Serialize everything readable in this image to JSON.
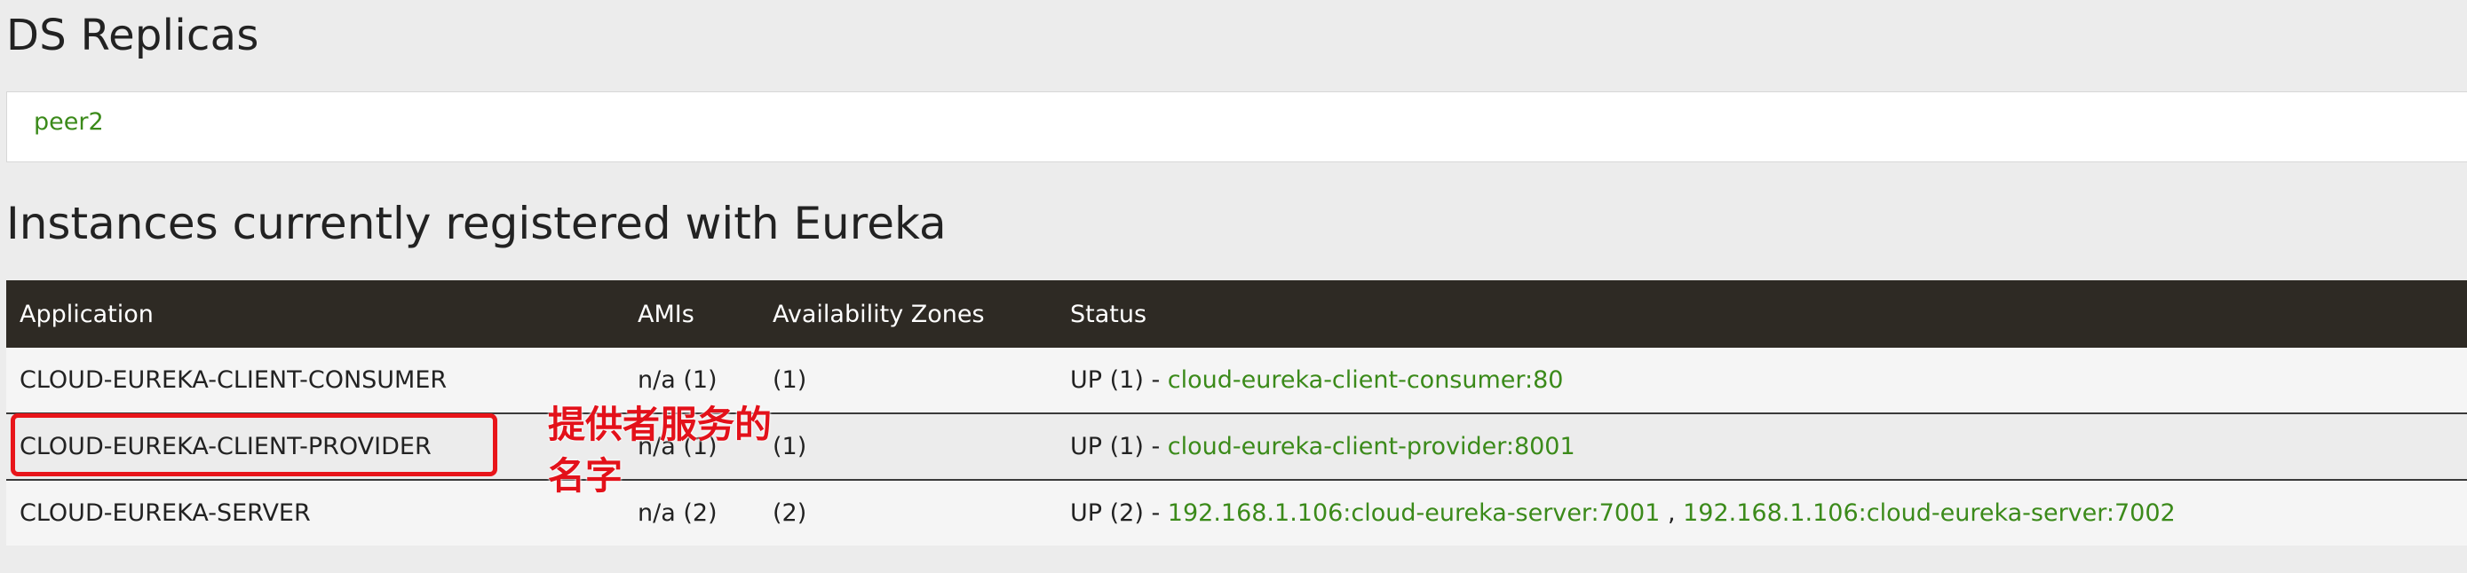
{
  "ds_replicas": {
    "heading": "DS Replicas",
    "peers": [
      "peer2"
    ]
  },
  "instances": {
    "heading": "Instances currently registered with Eureka",
    "columns": [
      "Application",
      "AMIs",
      "Availability Zones",
      "Status"
    ],
    "rows": [
      {
        "application": "CLOUD-EUREKA-CLIENT-CONSUMER",
        "amis": "n/a (1)",
        "zones": "(1)",
        "status_prefix": "UP (1) - ",
        "links": [
          "cloud-eureka-client-consumer:80"
        ]
      },
      {
        "application": "CLOUD-EUREKA-CLIENT-PROVIDER",
        "amis": "n/a (1)",
        "zones": "(1)",
        "status_prefix": "UP (1) - ",
        "links": [
          "cloud-eureka-client-provider:8001"
        ]
      },
      {
        "application": "CLOUD-EUREKA-SERVER",
        "amis": "n/a (2)",
        "zones": "(2)",
        "status_prefix": "UP (2) - ",
        "links": [
          "192.168.1.106:cloud-eureka-server:7001",
          "192.168.1.106:cloud-eureka-server:7002"
        ],
        "link_separator": " , "
      }
    ]
  },
  "annotation": {
    "line1": "提供者服务的",
    "line2": "名字",
    "color": "#e3111a"
  },
  "colors": {
    "link": "#3b8a1a",
    "header_bg": "#2e2a24",
    "page_bg": "#ececec"
  }
}
